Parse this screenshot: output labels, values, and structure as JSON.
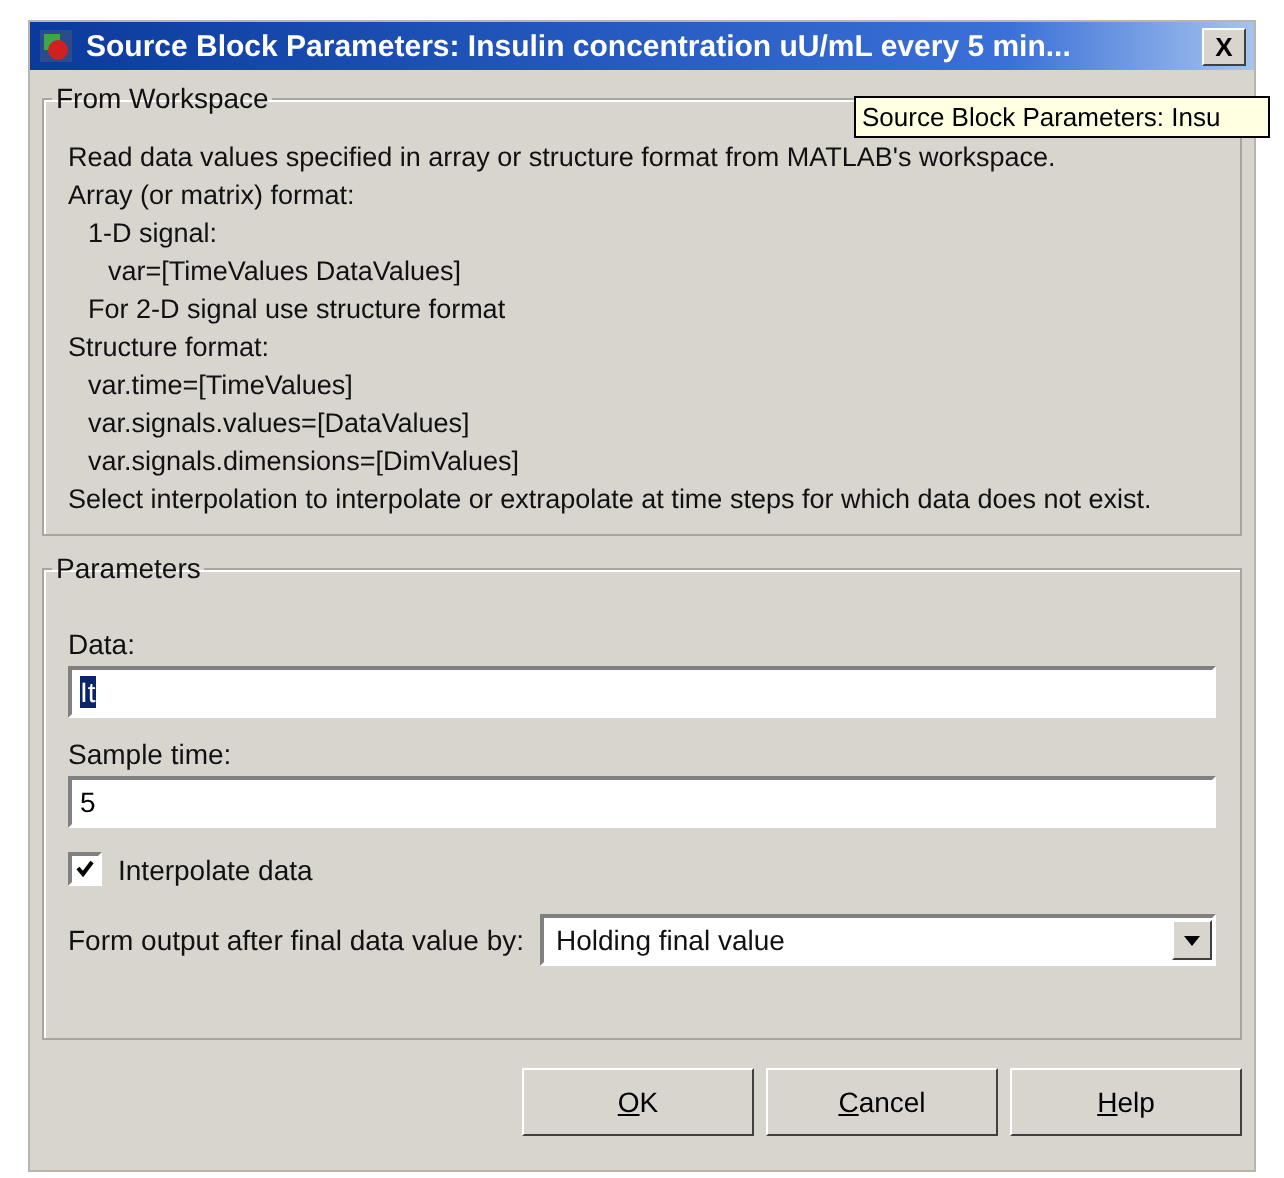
{
  "window": {
    "title": "Source Block Parameters: Insulin concentration uU/mL every 5 min...",
    "close": "X"
  },
  "tooltip": {
    "text": "Source Block Parameters: Insu"
  },
  "description": {
    "title": "From Workspace",
    "lines": [
      {
        "text": "Read data values specified in array or structure format from MATLAB's workspace."
      },
      {
        "text": "Array (or matrix) format:",
        "children": [
          {
            "text": "1-D signal:",
            "children": [
              {
                "text": "var=[TimeValues DataValues]"
              }
            ]
          },
          {
            "text": "For 2-D signal use structure format"
          }
        ]
      },
      {
        "text": "Structure format:",
        "children": [
          {
            "text": "var.time=[TimeValues]"
          },
          {
            "text": "var.signals.values=[DataValues]"
          },
          {
            "text": "var.signals.dimensions=[DimValues]"
          }
        ]
      },
      {
        "text": "Select interpolation to interpolate or extrapolate at time steps for which data does not exist."
      }
    ]
  },
  "parameters": {
    "title": "Parameters",
    "fields": [
      {
        "label": "Data:",
        "value": "It",
        "selected": true
      },
      {
        "label": "Sample time:",
        "value": "5",
        "selected": false
      }
    ],
    "checkbox": {
      "label": "Interpolate data",
      "checked": true
    },
    "dropdown": {
      "label": "Form output after final data value by:",
      "value": "Holding final value"
    }
  },
  "buttons": [
    {
      "label": "OK",
      "underline_first": true
    },
    {
      "label": "Cancel",
      "underline_first": true
    },
    {
      "label": "Help",
      "underline_first": true
    }
  ]
}
